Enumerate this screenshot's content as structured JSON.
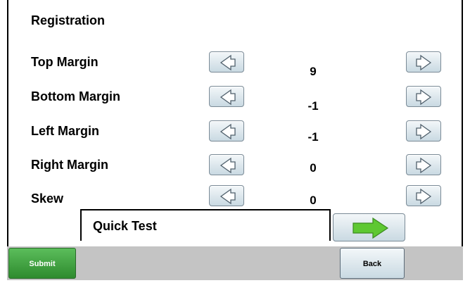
{
  "title": "Registration",
  "rows": [
    {
      "label": "Top Margin",
      "value": "9"
    },
    {
      "label": "Bottom Margin",
      "value": "-1"
    },
    {
      "label": "Left Margin",
      "value": "-1"
    },
    {
      "label": "Right Margin",
      "value": "0"
    },
    {
      "label": "Skew",
      "value": "0"
    }
  ],
  "quick_test": {
    "label": "Quick Test",
    "go_icon": "green-right-arrow-icon"
  },
  "footer": {
    "submit_label": "Submit",
    "back_label": "Back"
  },
  "colors": {
    "submit_green": "#3a9d3a",
    "go_arrow_green": "#5ec832",
    "button_blue": "#d6e3ea"
  }
}
